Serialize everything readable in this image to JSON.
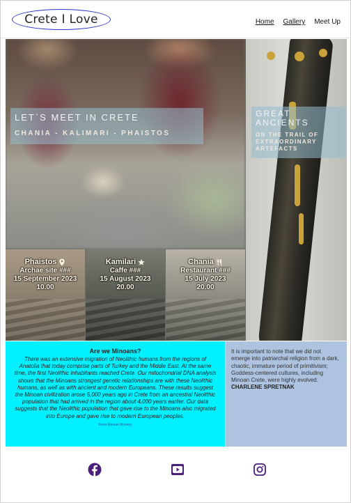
{
  "header": {
    "logo": "Crete I Love",
    "nav": [
      "Home",
      "Gallery",
      "Meet Up"
    ]
  },
  "hero": {
    "meet_title": "Let`s meet in Crete",
    "meet_subtitle": "Chania - Kalimari - Phaistos",
    "ancients_title": "Great Ancients",
    "ancients_subtitle": "On the trail of extraordinary artefacts"
  },
  "events": [
    {
      "place": "Phaistos",
      "icon": "map-marker-icon",
      "venue": "Archae site ###",
      "date": "15 September 2023",
      "time": "10.00"
    },
    {
      "place": "Kamilari",
      "icon": "star-icon",
      "venue": "Caffe ###",
      "date": "15 August 2023",
      "time": "20.00"
    },
    {
      "place": "Chania",
      "icon": "utensils-icon",
      "venue": "Restaurant ###",
      "date": "15 July 2023",
      "time": "20.00"
    }
  ],
  "quote_left": {
    "title": "Are we Minoans?",
    "body": "There was an extensive migration of Neolithic humans from the regions of Anatolia that today comprise parts of Turkey and the Middle East. At the same time, the first Neolithic inhabitants reached Crete. Our mitochondrial DNA analysis shows that the Minoans strongest genetic relationships are with these Neolithic humans, as well as with ancient and modern Europeans. These results suggest the Minoan civilization arose 5,000 years ago in Crete from an ancestral Neolithic population that had arrived in the region about 4,000 years earlier. Our data suggests that the Neolithic population that gave rise to the Minoans also migrated into Europe and gave rise to modern European peoples.",
    "source": "From Minoan Mystery"
  },
  "quote_right": {
    "body": "It is important to note that we did not emerge into patriarchal religion from a dark, chaotic, immature period of primitivism; Goddess-centered cultures, including Minoan Crete, were highly evolved.",
    "author": "CHARLENE SPRETNAK"
  },
  "footer": {
    "icons": [
      "facebook-icon",
      "youtube-icon",
      "instagram-icon"
    ],
    "icon_color": "#4b1f7a"
  },
  "colors": {
    "accent_cyan": "#00f0ff",
    "quote_blue": "#adc3e0",
    "logo_border": "#2a36c4"
  }
}
